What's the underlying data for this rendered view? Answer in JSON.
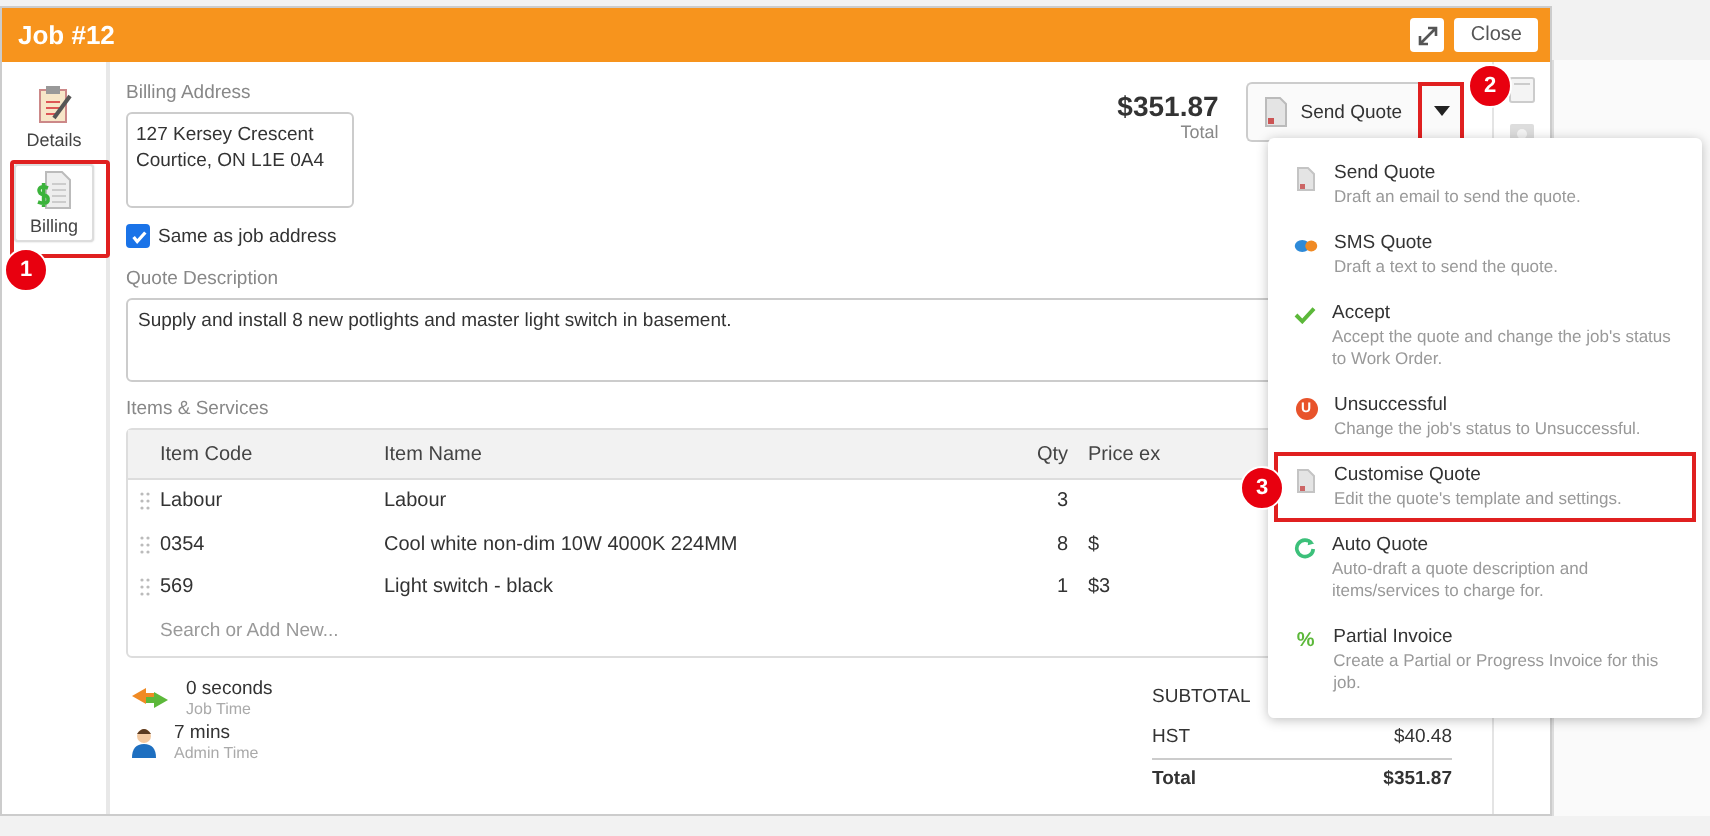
{
  "window": {
    "title": "Job #12",
    "close_button": "Close"
  },
  "sidebar": {
    "items": [
      {
        "label": "Details",
        "kind": "clipboard",
        "selected": false
      },
      {
        "label": "Billing",
        "kind": "billing",
        "selected": true
      }
    ]
  },
  "billing": {
    "label": "Billing Address",
    "address": "127 Kersey Crescent\nCourtice, ON L1E 0A4",
    "same_as_job": {
      "label": "Same as job address",
      "checked": true
    }
  },
  "quote_description": {
    "label": "Quote Description",
    "value": "Supply and install 8 new potlights and master light switch in basement."
  },
  "total": {
    "amount": "$351.87",
    "label": "Total"
  },
  "send_button": "Send Quote",
  "items": {
    "label": "Items & Services",
    "columns": [
      "Item Code",
      "Item Name",
      "Qty",
      "Price ex"
    ],
    "rows": [
      {
        "code": "Labour",
        "name": "Labour",
        "qty": "3"
      },
      {
        "code": "0354",
        "name": "Cool white non-dim 10W 4000K 224MM",
        "qty": "8",
        "price": "$"
      },
      {
        "code": "569",
        "name": "Light switch - black",
        "qty": "1",
        "price": "$3"
      }
    ],
    "search_placeholder": "Search or Add New..."
  },
  "times": [
    {
      "value": "0 seconds",
      "label": "Job Time",
      "kind": "arrows"
    },
    {
      "value": "7 mins",
      "label": "Admin Time",
      "kind": "person"
    }
  ],
  "summary": [
    {
      "label": "SUBTOTAL"
    },
    {
      "label": "HST",
      "value": "$40.48"
    },
    {
      "label": "Total",
      "value": "$351.87"
    }
  ],
  "menu": [
    {
      "title": "Send Quote",
      "description": "Draft an email to send the quote.",
      "kind": "doc",
      "highlighted": false
    },
    {
      "title": "SMS Quote",
      "description": "Draft a text to send the quote.",
      "kind": "sms",
      "highlighted": false
    },
    {
      "title": "Accept",
      "description": "Accept the quote and change the job's status to Work Order.",
      "kind": "check",
      "highlighted": false
    },
    {
      "title": "Unsuccessful",
      "description": "Change the job's status to Unsuccessful.",
      "kind": "u",
      "icon_text": "U",
      "highlighted": false
    },
    {
      "title": "Customise Quote",
      "description": "Edit the quote's template and settings.",
      "kind": "doc",
      "highlighted": true
    },
    {
      "title": "Auto Quote",
      "description": "Auto-draft a quote description and items/services to charge for.",
      "kind": "cycle",
      "highlighted": false
    },
    {
      "title": "Partial Invoice",
      "description": "Create a Partial or Progress Invoice for this job.",
      "kind": "percent",
      "icon_text": "%",
      "highlighted": false
    }
  ],
  "callouts": [
    "1",
    "2",
    "3"
  ]
}
